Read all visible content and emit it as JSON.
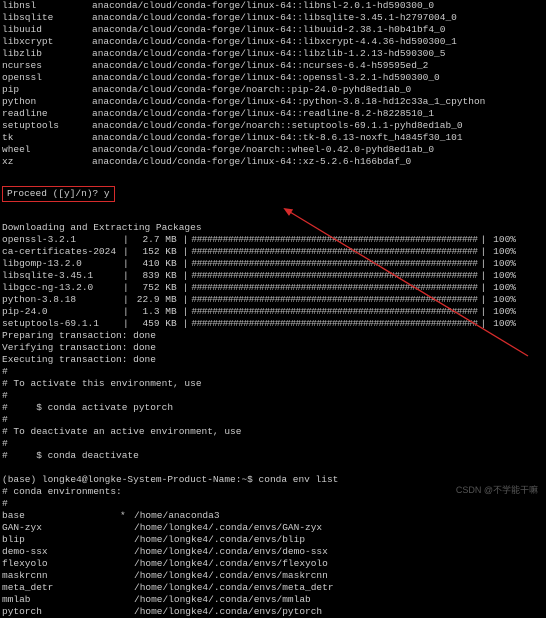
{
  "packages": [
    {
      "name": "libnsl",
      "spec": "anaconda/cloud/conda-forge/linux-64::libnsl-2.0.1-hd590300_0"
    },
    {
      "name": "libsqlite",
      "spec": "anaconda/cloud/conda-forge/linux-64::libsqlite-3.45.1-h2797004_0"
    },
    {
      "name": "libuuid",
      "spec": "anaconda/cloud/conda-forge/linux-64::libuuid-2.38.1-h0b41bf4_0"
    },
    {
      "name": "libxcrypt",
      "spec": "anaconda/cloud/conda-forge/linux-64::libxcrypt-4.4.36-hd590300_1"
    },
    {
      "name": "libzlib",
      "spec": "anaconda/cloud/conda-forge/linux-64::libzlib-1.2.13-hd590300_5"
    },
    {
      "name": "ncurses",
      "spec": "anaconda/cloud/conda-forge/linux-64::ncurses-6.4-h59595ed_2"
    },
    {
      "name": "openssl",
      "spec": "anaconda/cloud/conda-forge/linux-64::openssl-3.2.1-hd590300_0"
    },
    {
      "name": "pip",
      "spec": "anaconda/cloud/conda-forge/noarch::pip-24.0-pyhd8ed1ab_0"
    },
    {
      "name": "python",
      "spec": "anaconda/cloud/conda-forge/linux-64::python-3.8.18-hd12c33a_1_cpython"
    },
    {
      "name": "readline",
      "spec": "anaconda/cloud/conda-forge/linux-64::readline-8.2-h8228510_1"
    },
    {
      "name": "setuptools",
      "spec": "anaconda/cloud/conda-forge/noarch::setuptools-69.1.1-pyhd8ed1ab_0"
    },
    {
      "name": "tk",
      "spec": "anaconda/cloud/conda-forge/linux-64::tk-8.6.13-noxft_h4845f30_101"
    },
    {
      "name": "wheel",
      "spec": "anaconda/cloud/conda-forge/noarch::wheel-0.42.0-pyhd8ed1ab_0"
    },
    {
      "name": "xz",
      "spec": "anaconda/cloud/conda-forge/linux-64::xz-5.2.6-h166bdaf_0"
    }
  ],
  "proceed": {
    "prompt": "Proceed ([y]/n)? ",
    "answer": "y"
  },
  "download_header": "Downloading and Extracting Packages",
  "downloads": [
    {
      "name": "openssl-3.2.1",
      "size": "2.7 MB",
      "pct": "100%"
    },
    {
      "name": "ca-certificates-2024",
      "size": "152 KB",
      "pct": "100%"
    },
    {
      "name": "libgomp-13.2.0",
      "size": "410 KB",
      "pct": "100%"
    },
    {
      "name": "libsqlite-3.45.1",
      "size": "839 KB",
      "pct": "100%"
    },
    {
      "name": "libgcc-ng-13.2.0",
      "size": "752 KB",
      "pct": "100%"
    },
    {
      "name": "python-3.8.18",
      "size": "22.9 MB",
      "pct": "100%"
    },
    {
      "name": "pip-24.0",
      "size": "1.3 MB",
      "pct": "100%"
    },
    {
      "name": "setuptools-69.1.1",
      "size": "459 KB",
      "pct": "100%"
    }
  ],
  "bar_str": "#######################################################",
  "transactions": [
    "Preparing transaction: done",
    "Verifying transaction: done",
    "Executing transaction: done"
  ],
  "messages": [
    "#",
    "# To activate this environment, use",
    "#",
    "#     $ conda activate pytorch",
    "#",
    "# To deactivate an active environment, use",
    "#",
    "#     $ conda deactivate",
    ""
  ],
  "shell": {
    "prompt": "(base) longke4@longke-System-Product-Name:~$ ",
    "command": "conda env list"
  },
  "env_header": "# conda environments:",
  "env_hash": "#",
  "envs": [
    {
      "name": "base",
      "star": "*",
      "path": "/home/anaconda3"
    },
    {
      "name": "GAN-zyx",
      "star": "",
      "path": "/home/longke4/.conda/envs/GAN-zyx"
    },
    {
      "name": "blip",
      "star": "",
      "path": "/home/longke4/.conda/envs/blip"
    },
    {
      "name": "demo-ssx",
      "star": "",
      "path": "/home/longke4/.conda/envs/demo-ssx"
    },
    {
      "name": "flexyolo",
      "star": "",
      "path": "/home/longke4/.conda/envs/flexyolo"
    },
    {
      "name": "maskrcnn",
      "star": "",
      "path": "/home/longke4/.conda/envs/maskrcnn"
    },
    {
      "name": "meta_detr",
      "star": "",
      "path": "/home/longke4/.conda/envs/meta_detr"
    },
    {
      "name": "mmlab",
      "star": "",
      "path": "/home/longke4/.conda/envs/mmlab"
    },
    {
      "name": "pytorch",
      "star": "",
      "path": "/home/longke4/.conda/envs/pytorch"
    }
  ],
  "watermark": "CSDN @不学能干嘛"
}
